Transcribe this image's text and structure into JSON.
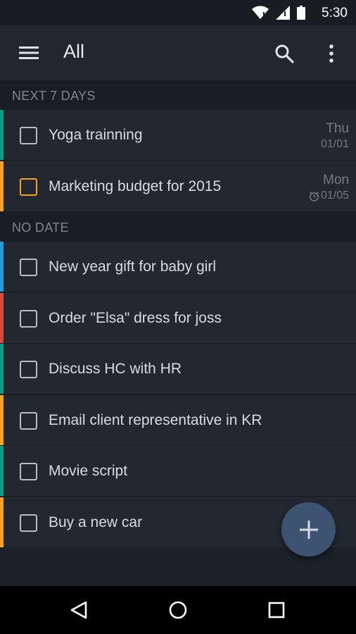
{
  "status_bar": {
    "time": "5:30",
    "icons": [
      "wifi-icon",
      "signal-icon",
      "battery-icon"
    ]
  },
  "app_bar": {
    "title": "All",
    "icons": [
      "menu-icon",
      "search-icon",
      "more-vert-icon"
    ]
  },
  "sections": [
    {
      "header": "NEXT 7 DAYS",
      "tasks": [
        {
          "label": "Yoga trainning",
          "day": "Thu",
          "date": "01/01",
          "color": "#0f9c84",
          "checkbox_color": "#b9bdc4",
          "alarm": false
        },
        {
          "label": "Marketing budget for 2015",
          "day": "Mon",
          "date": "01/05",
          "color": "#f0a328",
          "checkbox_color": "#f0a328",
          "alarm": true
        }
      ]
    },
    {
      "header": "NO DATE",
      "tasks": [
        {
          "label": "New year gift for baby girl",
          "color": "#2a9ad6"
        },
        {
          "label": "Order \"Elsa\" dress for joss",
          "color": "#d34a3e"
        },
        {
          "label": "Discuss HC with HR",
          "color": "#0f9c84"
        },
        {
          "label": "Email client representative in KR",
          "color": "#f0a328"
        },
        {
          "label": "Movie script",
          "color": "#0f9c84"
        },
        {
          "label": "Buy a new car",
          "color": "#f0a328"
        }
      ]
    }
  ],
  "fab": {
    "icon": "plus-icon",
    "color": "#3d5372"
  },
  "nav_bar": {
    "icons": [
      "back-icon",
      "home-icon",
      "recents-icon"
    ]
  }
}
